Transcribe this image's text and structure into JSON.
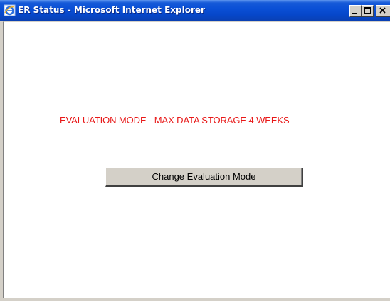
{
  "window": {
    "title": "ER Status - Microsoft Internet Explorer",
    "icon": "internet-explorer-icon",
    "controls": [
      "minimize-icon",
      "maximize-icon",
      "close-icon"
    ]
  },
  "main": {
    "message": "EVALUATION MODE - MAX DATA STORAGE 4 WEEKS",
    "button_label": "Change Evaluation Mode"
  },
  "colors": {
    "titlebar": "#0a4fd6",
    "message": "#e81818",
    "button_face": "#d4d0c8",
    "content_background": "#ffffff"
  }
}
